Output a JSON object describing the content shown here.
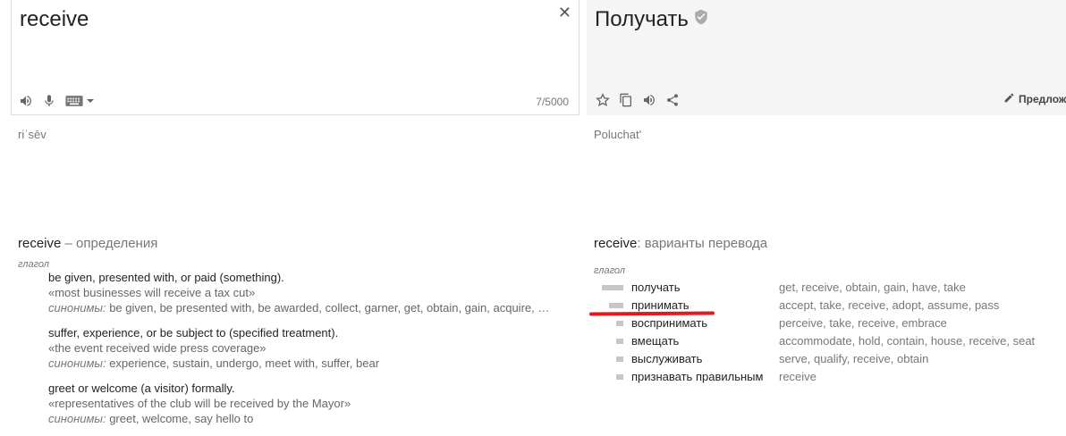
{
  "source": {
    "text": "receive",
    "char_count": "7/5000",
    "clear_icon": "close-icon",
    "tools": [
      "speaker-icon",
      "microphone-icon",
      "keyboard-icon",
      "chevron-down-icon"
    ]
  },
  "target": {
    "text": "Получать",
    "verified_icon": "shield-check-icon",
    "tools": [
      "star-icon",
      "copy-icon",
      "speaker-icon",
      "share-icon"
    ],
    "suggest_label": "Предложи"
  },
  "transliteration": {
    "source": "riˈsēv",
    "target": "Poluchat'"
  },
  "definitions": {
    "word": "receive",
    "title_suffix": " – определения",
    "pos": "глагол",
    "synonyms_label": "синонимы:",
    "items": [
      {
        "gloss": "be given, presented with, or paid (something).",
        "example": "«most businesses will receive a tax cut»",
        "synonyms": " be given, be presented with, be awarded, collect, garner, get, obtain, gain, acquire, …"
      },
      {
        "gloss": "suffer, experience, or be subject to (specified treatment).",
        "example": "«the event received wide press coverage»",
        "synonyms": " experience, sustain, undergo, meet with, suffer, bear"
      },
      {
        "gloss": "greet or welcome (a visitor) formally.",
        "example": "«representatives of the club will be received by the Mayor»",
        "synonyms": " greet, welcome, say hello to"
      }
    ]
  },
  "translations": {
    "word": "receive",
    "title_suffix": ": варианты перевода",
    "pos": "глагол",
    "rows": [
      {
        "word": "получать",
        "back": "get, receive, obtain, gain, have, take",
        "frequency": 1.0
      },
      {
        "word": "принимать",
        "back": "accept, take, receive, adopt, assume, pass",
        "frequency": 0.66
      },
      {
        "word": "воспринимать",
        "back": "perceive, take, receive, embrace",
        "frequency": 0.33
      },
      {
        "word": "вмещать",
        "back": "accommodate, hold, contain, house, receive, seat",
        "frequency": 0.33
      },
      {
        "word": "выслуживать",
        "back": "serve, qualify, receive, obtain",
        "frequency": 0.33
      },
      {
        "word": "признавать правильным",
        "back": "receive",
        "frequency": 0.33
      }
    ]
  },
  "colors": {
    "annotation_underline": "#e2191e",
    "frequency_bar": "#c6c6c6",
    "target_panel_bg": "#f5f5f5"
  }
}
